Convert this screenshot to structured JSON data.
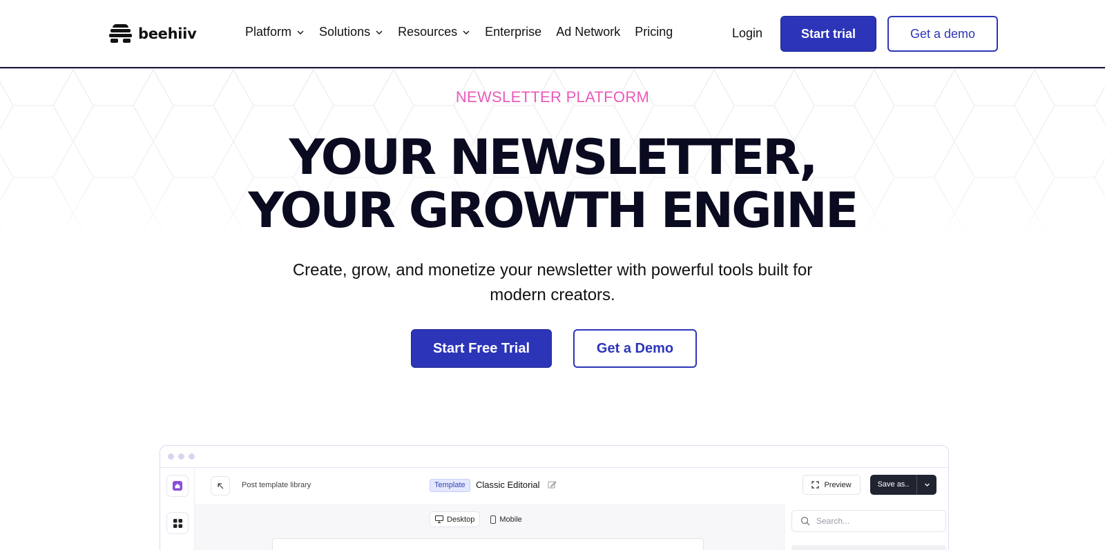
{
  "brand": {
    "name": "beehiiv"
  },
  "nav": {
    "items": [
      {
        "label": "Platform",
        "dropdown": true
      },
      {
        "label": "Solutions",
        "dropdown": true
      },
      {
        "label": "Resources",
        "dropdown": true
      },
      {
        "label": "Enterprise",
        "dropdown": false
      },
      {
        "label": "Ad Network",
        "dropdown": false
      },
      {
        "label": "Pricing",
        "dropdown": false
      }
    ],
    "login": "Login",
    "start_trial": "Start trial",
    "get_demo": "Get a demo"
  },
  "hero": {
    "eyebrow": "NEWSLETTER PLATFORM",
    "headline_line1": "YOUR NEWSLETTER,",
    "headline_line2": "YOUR GROWTH ENGINE",
    "subhead": "Create, grow, and monetize your newsletter with powerful tools built for modern creators.",
    "cta_primary": "Start Free Trial",
    "cta_secondary": "Get a Demo"
  },
  "app_preview": {
    "breadcrumb": "Post template library",
    "badge": "Template",
    "template_name": "Classic Editorial",
    "preview_label": "Preview",
    "save_label": "Save as..",
    "view_desktop": "Desktop",
    "view_mobile": "Mobile",
    "search_placeholder": "Search..."
  },
  "colors": {
    "accent": "#2c35b8",
    "eyebrow": "#ea5ab9",
    "headline": "#0a0a20"
  }
}
